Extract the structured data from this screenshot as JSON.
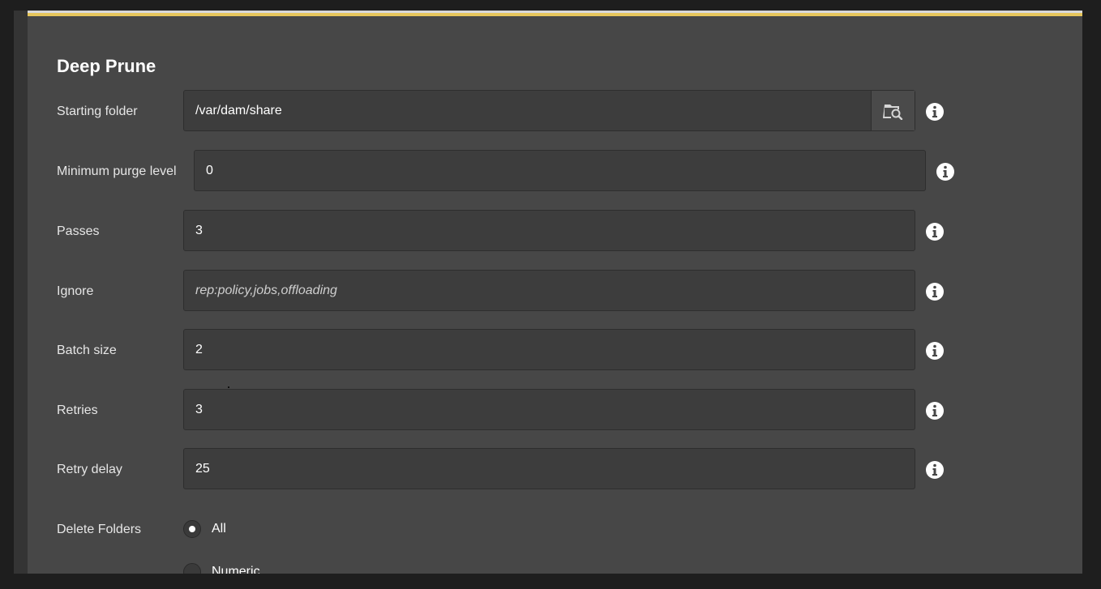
{
  "form": {
    "title": "Deep Prune",
    "fields": {
      "starting_folder": {
        "label": "Starting folder",
        "value": "/var/dam/share"
      },
      "minimum_purge_level": {
        "label": "Minimum purge level",
        "value": "0"
      },
      "passes": {
        "label": "Passes",
        "value": "3"
      },
      "ignore": {
        "label": "Ignore",
        "value": "",
        "placeholder": "rep:policy,jobs,offloading"
      },
      "batch_size": {
        "label": "Batch size",
        "value": "2"
      },
      "retries": {
        "label": "Retries",
        "value": "3"
      },
      "retry_delay": {
        "label": "Retry delay",
        "value": "25"
      }
    },
    "delete_folders": {
      "label": "Delete Folders",
      "options": [
        "All",
        "Numeric"
      ],
      "selected": "All"
    }
  },
  "icons": {
    "browse": "folder-search-icon",
    "info": "info-icon"
  },
  "colors": {
    "accent": "#e6c65c",
    "panel_background": "#474747",
    "field_background": "#3d3d3d"
  }
}
